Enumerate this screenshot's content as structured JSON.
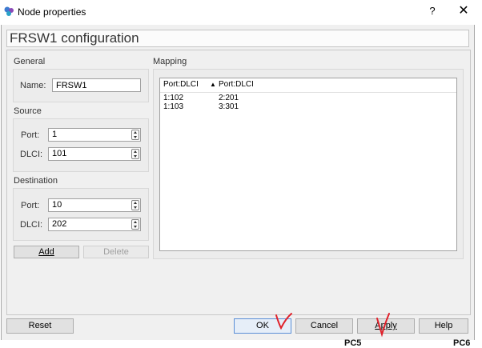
{
  "window": {
    "title": "Node properties",
    "help_glyph": "?",
    "close_glyph": "✕"
  },
  "header": {
    "text": "FRSW1 configuration"
  },
  "general": {
    "section_label": "General",
    "name_label": "Name:",
    "name_value": "FRSW1"
  },
  "source": {
    "section_label": "Source",
    "port_label": "Port:",
    "port_value": "1",
    "dlci_label": "DLCI:",
    "dlci_value": "101"
  },
  "destination": {
    "section_label": "Destination",
    "port_label": "Port:",
    "port_value": "10",
    "dlci_label": "DLCI:",
    "dlci_value": "202"
  },
  "buttons": {
    "add": "Add",
    "delete": "Delete",
    "reset": "Reset",
    "ok": "OK",
    "cancel": "Cancel",
    "apply": "Apply",
    "help": "Help"
  },
  "mapping": {
    "section_label": "Mapping",
    "columns": [
      "Port:DLCI",
      "Port:DLCI"
    ],
    "sort_glyph": "▲",
    "rows": [
      [
        "1:102",
        "2:201"
      ],
      [
        "1:103",
        "3:301"
      ]
    ]
  },
  "background_labels": {
    "left": "PC5",
    "right": "PC6"
  },
  "annotation_color": "#e0202a"
}
